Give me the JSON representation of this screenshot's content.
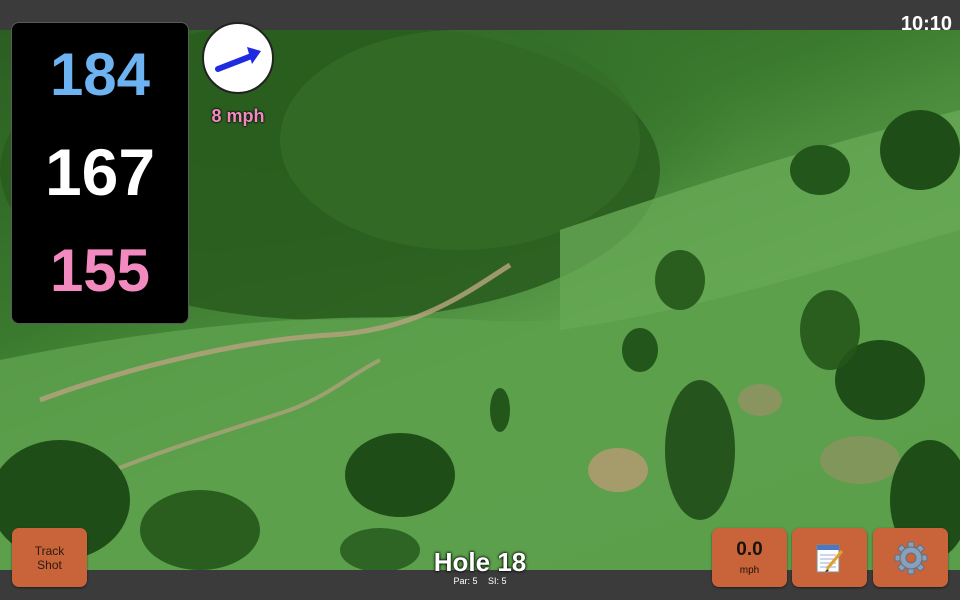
{
  "status_bar": {
    "time": "10:10"
  },
  "yardages": {
    "back": "184",
    "center": "167",
    "front": "155"
  },
  "wind": {
    "speed": "8 mph",
    "icon": "wind-direction-arrow-icon"
  },
  "hole": {
    "title": "Hole 18",
    "par": "Par: 5",
    "si": "SI: 5"
  },
  "buttons": {
    "track_shot": [
      "Track",
      "Shot"
    ],
    "speed_value": "0.0",
    "speed_unit": "mph",
    "scorecard_icon": "notepad-icon",
    "settings_icon": "gear-icon"
  },
  "colors": {
    "accent_button": "#c9643a",
    "back_yardage": "#6db3f2",
    "center_yardage": "#ffffff",
    "front_yardage": "#f28ac0",
    "wind_arrow": "#1f2be0"
  }
}
